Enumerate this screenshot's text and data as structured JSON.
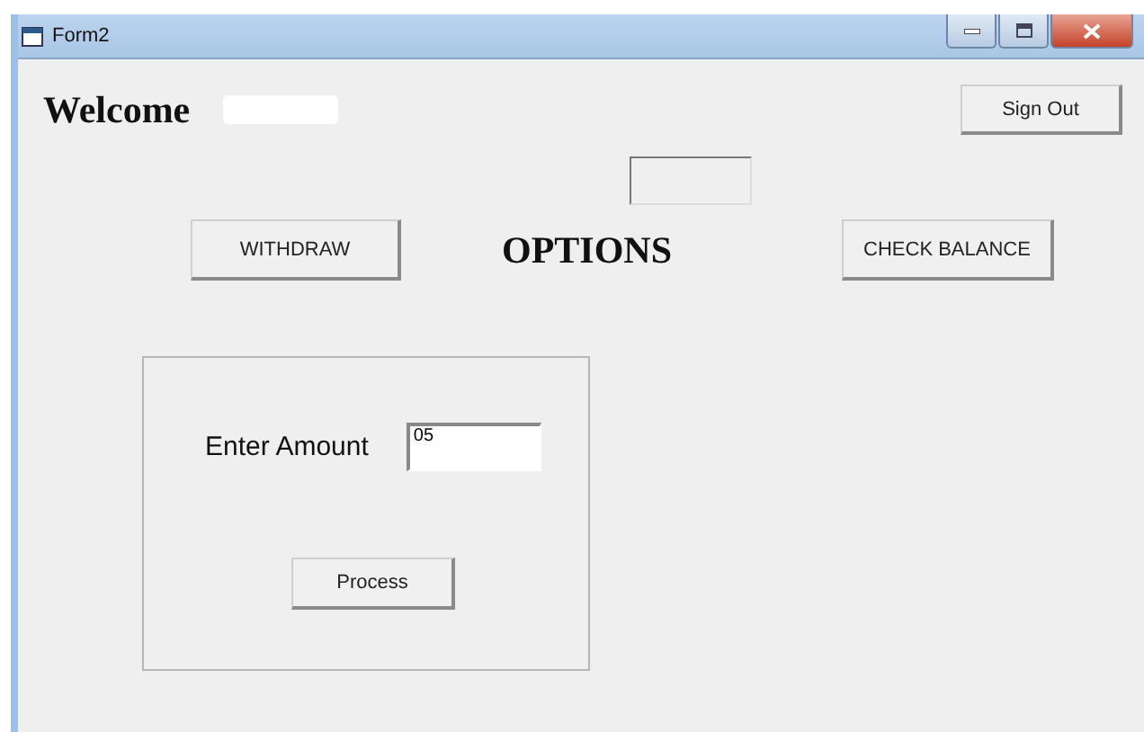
{
  "window": {
    "title": "Form2"
  },
  "welcome_label": "Welcome",
  "sign_out_button": "Sign Out",
  "options_heading": "OPTIONS",
  "option_buttons": [
    "WITHDRAW",
    "CHECK BALANCE"
  ],
  "amount_panel": {
    "label": "Enter Amount",
    "value": "05",
    "button": "Process"
  }
}
